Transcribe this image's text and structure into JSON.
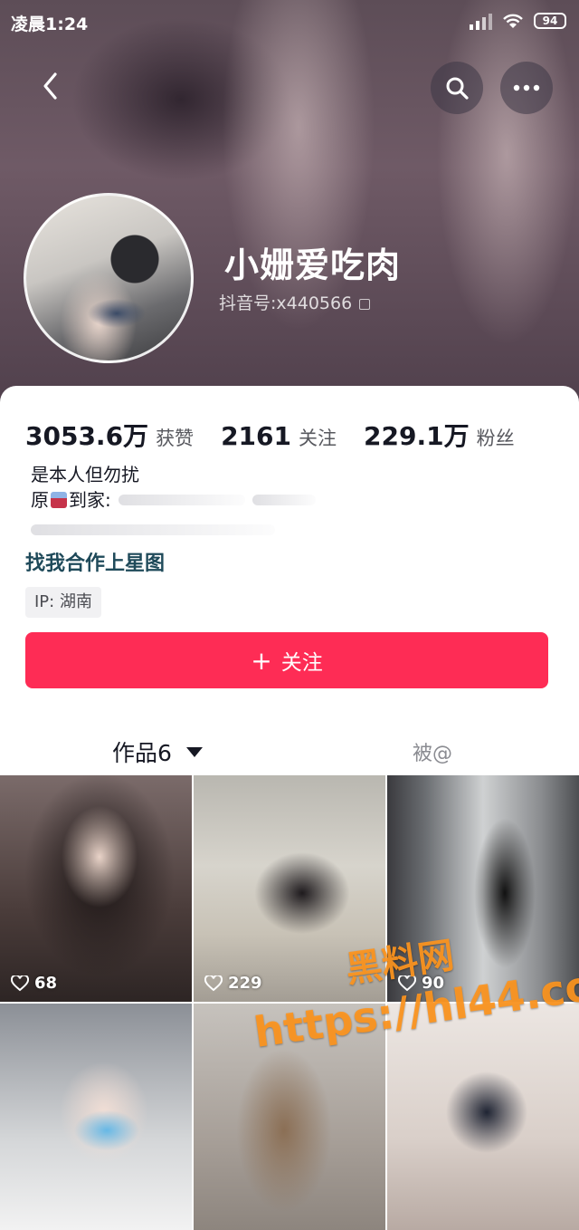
{
  "status_bar": {
    "time": "凌晨1:24",
    "battery": "94"
  },
  "profile": {
    "nickname": "小姗爱吃肉",
    "douyin_id": "抖音号:x440566"
  },
  "stats": [
    {
      "value": "3053.6万",
      "label": "获赞"
    },
    {
      "value": "2161",
      "label": "关注"
    },
    {
      "value": "229.1万",
      "label": "粉丝"
    }
  ],
  "bio": {
    "line1": "是本人但勿扰",
    "line2_prefix": "原",
    "line2_suffix": "到家:"
  },
  "star_link": "找我合作上星图",
  "ip_tag": "IP: 湖南",
  "follow_button": {
    "icon": "plus-icon",
    "label": "关注"
  },
  "tabs": {
    "works": "作品6",
    "mentioned": "被@"
  },
  "videos": [
    {
      "likes": "68"
    },
    {
      "likes": "229"
    },
    {
      "likes": "90"
    }
  ],
  "watermark": {
    "title": "黑料网",
    "url": "https://hl44.co"
  },
  "colors": {
    "accent": "#fe2c55",
    "link": "#1f4a5a",
    "watermark": "#ff961e"
  }
}
